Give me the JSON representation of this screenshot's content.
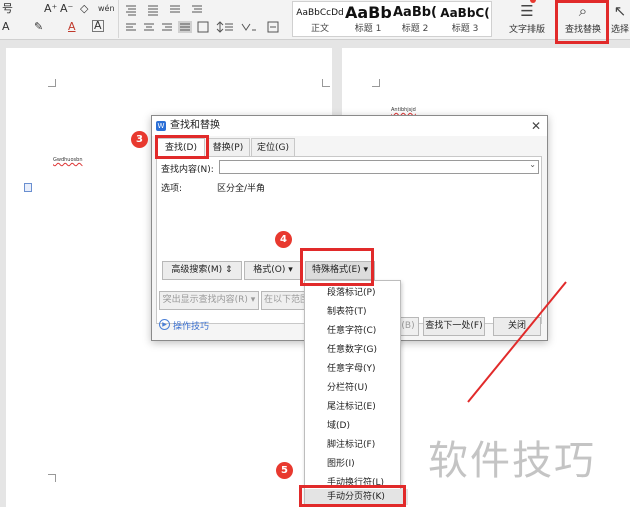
{
  "ribbon": {
    "font_row1": [
      "号",
      "A⁺",
      "A⁻",
      "◇",
      "wén"
    ],
    "font_row2": [
      "A",
      "✎",
      "A",
      "A"
    ],
    "styles": [
      {
        "sample": "AaBbCcDd",
        "name": "正文"
      },
      {
        "sample": "AaBb",
        "name": "标题 1"
      },
      {
        "sample": "AaBb(",
        "name": "标题 2"
      },
      {
        "sample": "AaBbC(",
        "name": "标题 3"
      }
    ],
    "text_layout_label": "文字排版",
    "find_replace_label": "查找替换",
    "select_label": "选择"
  },
  "page_left": {
    "text": "Gwdhuosbn"
  },
  "page_right": {
    "text": "Antibhjsjd"
  },
  "dialog": {
    "title": "查找和替换",
    "tabs": [
      "查找(D)",
      "替换(P)",
      "定位(G)"
    ],
    "find_label": "查找内容(N):",
    "find_value": "",
    "options_label": "选项:",
    "options_value": "区分全/半角",
    "advanced_search": "高级搜索(M)",
    "format": "格式(O)",
    "special_format": "特殊格式(E)",
    "highlight_all": "突出显示查找内容(R)",
    "find_in": "在以下范围",
    "find_prev": "(B)",
    "find_next": "查找下一处(F)",
    "close": "关闭",
    "tips": "操作技巧"
  },
  "special_menu": [
    "段落标记(P)",
    "制表符(T)",
    "任意字符(C)",
    "任意数字(G)",
    "任意字母(Y)",
    "分栏符(U)",
    "尾注标记(E)",
    "域(D)",
    "脚注标记(F)",
    "图形(I)",
    "手动换行符(L)",
    "手动分页符(K)"
  ],
  "markers": [
    "3",
    "4",
    "5"
  ],
  "watermark": "软件技巧",
  "colors": {
    "accent": "#e12a2a",
    "marker": "#e8392f",
    "link": "#3a6fcf"
  }
}
